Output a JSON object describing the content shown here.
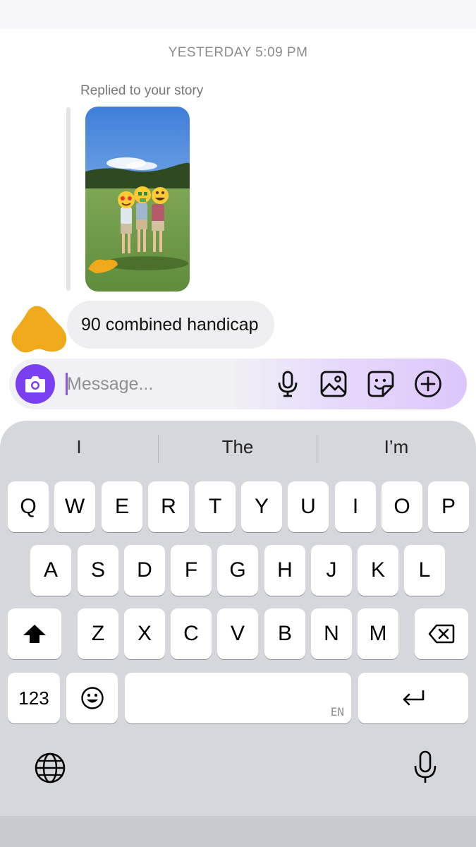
{
  "thread": {
    "timestamp": "YESTERDAY 5:09 PM",
    "reply_label": "Replied to your story",
    "message_text": "90 combined handicap"
  },
  "composer": {
    "placeholder": "Message...",
    "icons": [
      "camera-icon",
      "microphone-icon",
      "gallery-icon",
      "sticker-icon",
      "plus-icon"
    ]
  },
  "keyboard": {
    "suggestions": [
      "I",
      "The",
      "I’m"
    ],
    "row1": [
      "Q",
      "W",
      "E",
      "R",
      "T",
      "Y",
      "U",
      "I",
      "O",
      "P"
    ],
    "row2": [
      "A",
      "S",
      "D",
      "F",
      "G",
      "H",
      "J",
      "K",
      "L"
    ],
    "row3": [
      "Z",
      "X",
      "C",
      "V",
      "B",
      "N",
      "M"
    ],
    "numbers_key": "123",
    "space_language_tag": "EN"
  },
  "colors": {
    "accent": "#7b3ff2",
    "avatar": "#f0a91b",
    "bubble": "#efeff1",
    "keyboard_bg": "#d6d7dc"
  }
}
